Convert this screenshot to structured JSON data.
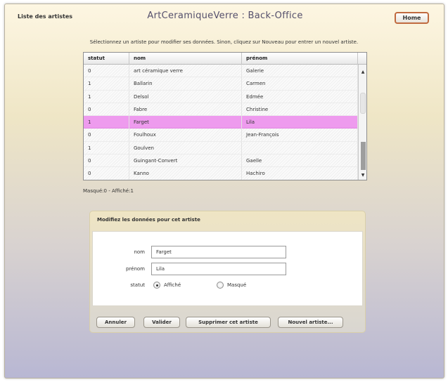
{
  "header": {
    "page_label": "Liste des artistes",
    "app_title": "ArtCeramiqueVerre : Back-Office",
    "home_label": "Home"
  },
  "instructions": "Sélectionnez un artiste pour modifier ses données. Sinon, cliquez sur Nouveau pour entrer un nouvel artiste.",
  "table": {
    "columns": [
      "statut",
      "nom",
      "prénom"
    ],
    "rows": [
      [
        "0",
        "art céramique verre",
        "Galerie"
      ],
      [
        "1",
        "Ballarin",
        "Carmen"
      ],
      [
        "1",
        "Delsol",
        "Edmée"
      ],
      [
        "0",
        "Fabre",
        "Christine"
      ],
      [
        "1",
        "Farget",
        "Lila"
      ],
      [
        "0",
        "Foulhoux",
        "Jean-François"
      ],
      [
        "1",
        "Goulven",
        ""
      ],
      [
        "0",
        "Guingant-Convert",
        "Gaelle"
      ],
      [
        "0",
        "Kanno",
        "Hachiro"
      ]
    ],
    "selected_row": 4,
    "selected_color": "#ee9bee"
  },
  "counts": "Masqué:0 - Affiché:1",
  "form": {
    "title": "Modifiez les données pour cet artiste",
    "nom_label": "nom",
    "nom_value": "Farget",
    "prenom_label": "prénom",
    "prenom_value": "Lila",
    "statut_label": "statut",
    "option_affiche": "Affiché",
    "option_masque": "Masqué",
    "selected_option": "Affiché"
  },
  "buttons": {
    "annuler": "Annuler",
    "valider": "Valider",
    "supprimer": "Supprimer cet artiste",
    "nouvel": "Nouvel artiste..."
  },
  "colors": {
    "home_border": "#c06a3f",
    "title_color": "#55506c"
  }
}
